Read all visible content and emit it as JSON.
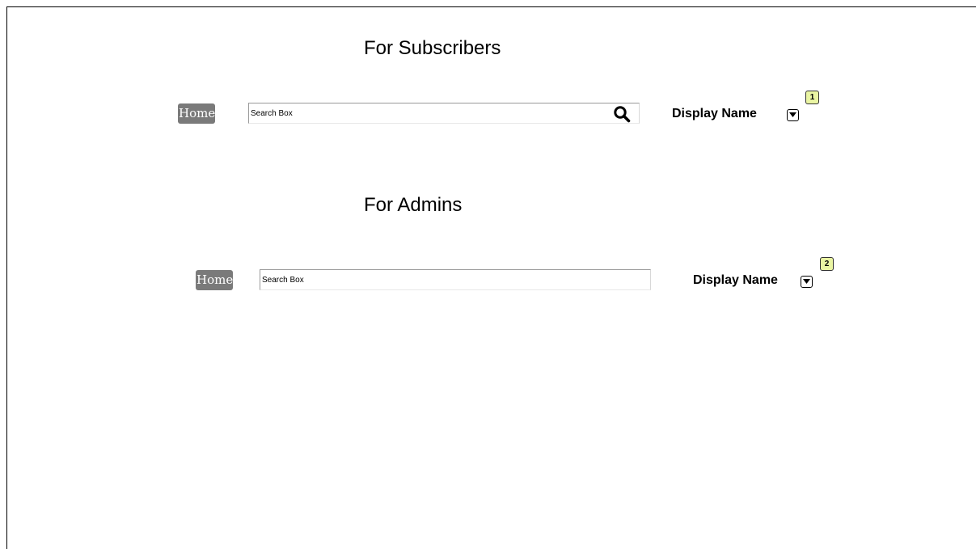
{
  "subscribers": {
    "title": "For Subscribers",
    "home_label": "Home",
    "search_placeholder": "Search Box",
    "display_name": "Display Name",
    "badge": "1"
  },
  "admins": {
    "title": "For Admins",
    "home_label": "Home",
    "search_placeholder": "Search Box",
    "display_name": "Display Name",
    "badge": "2"
  },
  "icons": {
    "search": "search-icon",
    "dropdown": "chevron-down-icon"
  },
  "colors": {
    "home_button_bg": "#7a7a7a",
    "badge_bg": "#eaf5a3"
  }
}
